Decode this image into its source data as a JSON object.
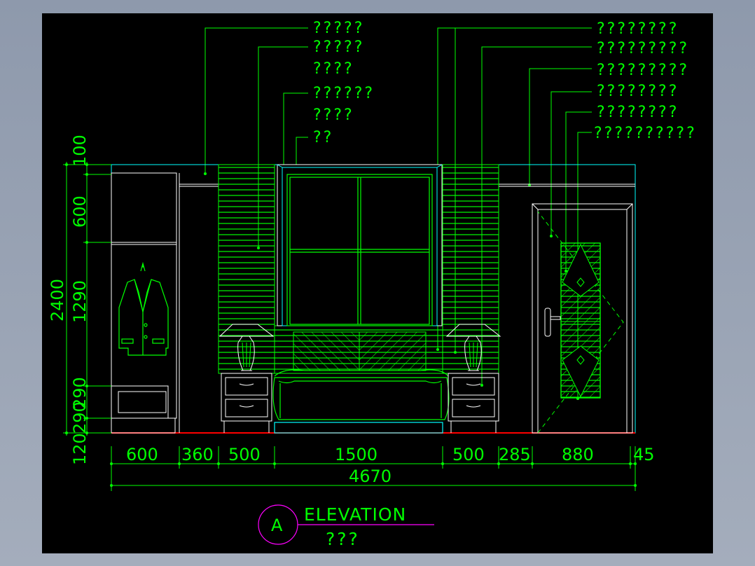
{
  "drawing": {
    "title": "ELEVATION",
    "marker": "A",
    "subtitle": "???"
  },
  "callouts_left": [
    {
      "lines": [
        "?????"
      ]
    },
    {
      "lines": [
        "?????",
        "????"
      ]
    },
    {
      "lines": [
        "??????",
        "????"
      ]
    },
    {
      "lines": [
        "??"
      ]
    }
  ],
  "callouts_right": [
    {
      "lines": [
        "????????"
      ]
    },
    {
      "lines": [
        "?????????"
      ]
    },
    {
      "lines": [
        "?????????"
      ]
    },
    {
      "lines": [
        "????????"
      ]
    },
    {
      "lines": [
        "????????"
      ]
    },
    {
      "lines": [
        "??????????"
      ]
    }
  ],
  "dimensions": {
    "horizontal": [
      "600",
      "360",
      "500",
      "1500",
      "500",
      "285",
      "880",
      "45"
    ],
    "total": "4670",
    "vertical_total": "2400",
    "vertical": [
      "100",
      "600",
      "1290",
      "290",
      "120"
    ],
    "vertical_extra": "290"
  },
  "colors": {
    "background": "#000000",
    "lines_green": "#00ff00",
    "lines_cyan": "#00ffff",
    "lines_white": "#ffffff",
    "marker_magenta": "#ff00ff",
    "floor_red": "#ff0000"
  }
}
